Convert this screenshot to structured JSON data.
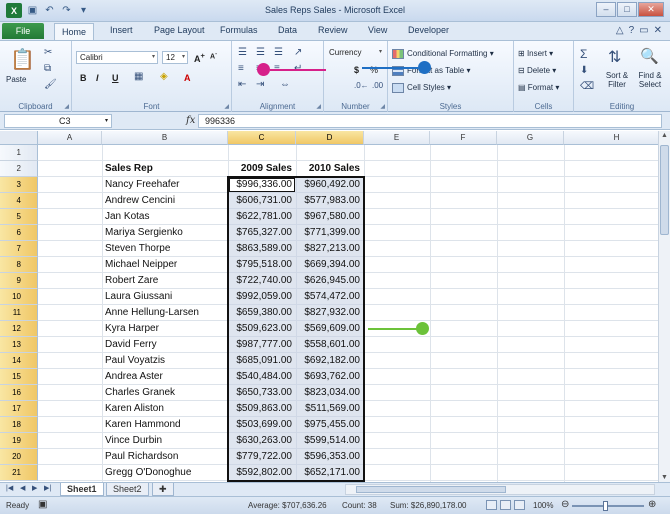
{
  "window": {
    "title": "Sales Reps Sales - Microsoft Excel",
    "minimize": "–",
    "maximize": "□",
    "close": "✕"
  },
  "tabs": [
    "File",
    "Home",
    "Insert",
    "Page Layout",
    "Formulas",
    "Data",
    "Review",
    "View",
    "Developer"
  ],
  "ribbon": {
    "clipboard": {
      "label": "Clipboard",
      "paste": "Paste"
    },
    "font": {
      "label": "Font",
      "name": "Calibri",
      "size": "12",
      "bold": "B",
      "italic": "I",
      "underline": "U"
    },
    "alignment": {
      "label": "Alignment"
    },
    "number": {
      "label": "Number",
      "format": "Currency",
      "dollar": "$",
      "percent": "%"
    },
    "styles": {
      "label": "Styles",
      "conditional": "Conditional Formatting",
      "format_table": "Format as Table",
      "cell_styles": "Cell Styles"
    },
    "cells": {
      "label": "Cells",
      "insert": "Insert",
      "delete": "Delete",
      "format": "Format"
    },
    "editing": {
      "label": "Editing",
      "sort": "Sort & Filter",
      "find": "Find & Select"
    }
  },
  "formula_bar": {
    "name_box": "C3",
    "fx": "fx",
    "content": "996336"
  },
  "columns": [
    "A",
    "B",
    "C",
    "D",
    "E",
    "F",
    "G",
    "H"
  ],
  "rows": [
    "1",
    "2",
    "3",
    "4",
    "5",
    "6",
    "7",
    "8",
    "9",
    "10",
    "11",
    "12",
    "13",
    "14",
    "15",
    "16",
    "17",
    "18",
    "19",
    "20",
    "21"
  ],
  "headers": {
    "rep": "Sales Rep",
    "y2009": "2009 Sales",
    "y2010": "2010 Sales"
  },
  "data": [
    [
      "Nancy Freehafer",
      "$996,336.00",
      "$960,492.00"
    ],
    [
      "Andrew Cencini",
      "$606,731.00",
      "$577,983.00"
    ],
    [
      "Jan Kotas",
      "$622,781.00",
      "$967,580.00"
    ],
    [
      "Mariya Sergienko",
      "$765,327.00",
      "$771,399.00"
    ],
    [
      "Steven Thorpe",
      "$863,589.00",
      "$827,213.00"
    ],
    [
      "Michael Neipper",
      "$795,518.00",
      "$669,394.00"
    ],
    [
      "Robert Zare",
      "$722,740.00",
      "$626,945.00"
    ],
    [
      "Laura Giussani",
      "$992,059.00",
      "$574,472.00"
    ],
    [
      "Anne Hellung-Larsen",
      "$659,380.00",
      "$827,932.00"
    ],
    [
      "Kyra Harper",
      "$509,623.00",
      "$569,609.00"
    ],
    [
      "David Ferry",
      "$987,777.00",
      "$558,601.00"
    ],
    [
      "Paul Voyatzis",
      "$685,091.00",
      "$692,182.00"
    ],
    [
      "Andrea Aster",
      "$540,484.00",
      "$693,762.00"
    ],
    [
      "Charles Granek",
      "$650,733.00",
      "$823,034.00"
    ],
    [
      "Karen Aliston",
      "$509,863.00",
      "$511,569.00"
    ],
    [
      "Karen Hammond",
      "$503,699.00",
      "$975,455.00"
    ],
    [
      "Vince Durbin",
      "$630,263.00",
      "$599,514.00"
    ],
    [
      "Paul Richardson",
      "$779,722.00",
      "$596,353.00"
    ],
    [
      "Gregg O'Donoghue",
      "$592,802.00",
      "$652,171.00"
    ]
  ],
  "sheets": [
    "Sheet1",
    "Sheet2"
  ],
  "status": {
    "ready": "Ready",
    "average": "Average: $707,636.26",
    "count": "Count: 38",
    "sum": "Sum: $26,890,178.00",
    "zoom": "100%"
  },
  "colors": {
    "annotation_magenta": "#d6208a",
    "annotation_blue": "#1e6fc4",
    "annotation_green": "#6cc23a"
  }
}
